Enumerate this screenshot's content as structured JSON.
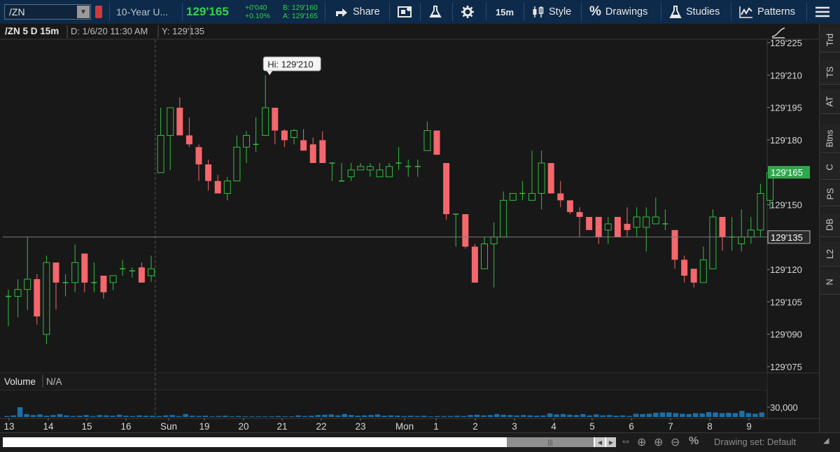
{
  "toolbar": {
    "symbol": "/ZN",
    "description": "10-Year U...",
    "last_price": "129'165",
    "net_change": "+0'040",
    "net_change_pct": "+0.10%",
    "bid": "B: 129'160",
    "ask": "A: 129'165",
    "share_label": "Share",
    "timeframe": "15m",
    "style_label": "Style",
    "drawings_label": "Drawings",
    "studies_label": "Studies",
    "patterns_label": "Patterns"
  },
  "chart_header": {
    "title": "/ZN 5 D 15m",
    "cursor_date": "D: 1/6/20 11:30 AM",
    "cursor_y": "Y: 129'135"
  },
  "volume_header": {
    "label": "Volume",
    "value": "N/A"
  },
  "sidebar": {
    "tabs": [
      "Trd",
      "TS",
      "AT",
      "Btns",
      "C",
      "PS",
      "DB",
      "L2",
      "N"
    ]
  },
  "bottom_bar": {
    "drawing_set": "Drawing set: Default"
  },
  "colors": {
    "up": "#2fbf3f",
    "down": "#f4676c",
    "price_label_bg": "#2ea84c",
    "toolbar_bg": "#0d2a4a"
  },
  "chart_data": {
    "type": "candlestick",
    "title": "/ZN 5 D 15m",
    "price_scale": "32nds",
    "y_ticks": [
      "129'225",
      "129'210",
      "129'195",
      "129'180",
      "129'150",
      "129'120",
      "129'105",
      "129'090",
      "129'075"
    ],
    "y_tick_values": [
      129.703125,
      129.65625,
      129.609375,
      129.5625,
      129.46875,
      129.375,
      129.328125,
      129.28125,
      129.234375
    ],
    "ylim": [
      129.234375,
      129.703125
    ],
    "x_labels": [
      "13",
      "14",
      "15",
      "16",
      "Sun",
      "19",
      "20",
      "21",
      "22",
      "23",
      "Mon",
      "1",
      "2",
      "3",
      "4",
      "5",
      "6",
      "7",
      "8",
      "9"
    ],
    "session_divider_after_label": "16",
    "annotation": {
      "text": "Hi: 129'210",
      "value": 129.65625,
      "bar_index": 27
    },
    "last_price": {
      "text": "129'165",
      "value": 129.515625
    },
    "cursor_price": {
      "text": "129'135",
      "value": 129.421875
    },
    "volume_tick": "30,000",
    "volume_tick_value": 30000,
    "candles": [
      {
        "o": 129.336,
        "h": 129.346,
        "l": 129.293,
        "c": 129.336
      },
      {
        "o": 129.336,
        "h": 129.361,
        "l": 129.306,
        "c": 129.346
      },
      {
        "o": 129.346,
        "h": 129.422,
        "l": 129.316,
        "c": 129.361
      },
      {
        "o": 129.361,
        "h": 129.368,
        "l": 129.295,
        "c": 129.307
      },
      {
        "o": 129.281,
        "h": 129.395,
        "l": 129.267,
        "c": 129.385
      },
      {
        "o": 129.385,
        "h": 129.385,
        "l": 129.317,
        "c": 129.356
      },
      {
        "o": 129.356,
        "h": 129.368,
        "l": 129.336,
        "c": 129.356
      },
      {
        "o": 129.356,
        "h": 129.411,
        "l": 129.342,
        "c": 129.385
      },
      {
        "o": 129.398,
        "h": 129.398,
        "l": 129.342,
        "c": 129.356
      },
      {
        "o": 129.356,
        "h": 129.385,
        "l": 129.342,
        "c": 129.356
      },
      {
        "o": 129.366,
        "h": 129.366,
        "l": 129.333,
        "c": 129.342
      },
      {
        "o": 129.356,
        "h": 129.366,
        "l": 129.345,
        "c": 129.366
      },
      {
        "o": 129.376,
        "h": 129.389,
        "l": 129.366,
        "c": 129.376
      },
      {
        "o": 129.373,
        "h": 129.378,
        "l": 129.363,
        "c": 129.373
      },
      {
        "o": 129.378,
        "h": 129.385,
        "l": 129.356,
        "c": 129.356
      },
      {
        "o": 129.366,
        "h": 129.395,
        "l": 129.357,
        "c": 129.376
      },
      {
        "o": 129.515,
        "h": 129.609,
        "l": 129.515,
        "c": 129.569
      },
      {
        "o": 129.569,
        "h": 129.609,
        "l": 129.519,
        "c": 129.609
      },
      {
        "o": 129.609,
        "h": 129.624,
        "l": 129.569,
        "c": 129.569
      },
      {
        "o": 129.569,
        "h": 129.595,
        "l": 129.552,
        "c": 129.556
      },
      {
        "o": 129.552,
        "h": 129.556,
        "l": 129.503,
        "c": 129.527
      },
      {
        "o": 129.527,
        "h": 129.534,
        "l": 129.489,
        "c": 129.503
      },
      {
        "o": 129.503,
        "h": 129.512,
        "l": 129.485,
        "c": 129.485
      },
      {
        "o": 129.485,
        "h": 129.509,
        "l": 129.475,
        "c": 129.503
      },
      {
        "o": 129.503,
        "h": 129.569,
        "l": 129.503,
        "c": 129.552
      },
      {
        "o": 129.552,
        "h": 129.575,
        "l": 129.529,
        "c": 129.569
      },
      {
        "o": 129.556,
        "h": 129.595,
        "l": 129.545,
        "c": 129.556
      },
      {
        "o": 129.569,
        "h": 129.656,
        "l": 129.569,
        "c": 129.609
      },
      {
        "o": 129.609,
        "h": 129.609,
        "l": 129.556,
        "c": 129.576
      },
      {
        "o": 129.576,
        "h": 129.578,
        "l": 129.552,
        "c": 129.562
      },
      {
        "o": 129.566,
        "h": 129.578,
        "l": 129.556,
        "c": 129.576
      },
      {
        "o": 129.562,
        "h": 129.578,
        "l": 129.547,
        "c": 129.547
      },
      {
        "o": 129.556,
        "h": 129.566,
        "l": 129.529,
        "c": 129.529
      },
      {
        "o": 129.562,
        "h": 129.575,
        "l": 129.529,
        "c": 129.529
      },
      {
        "o": 129.529,
        "h": 129.529,
        "l": 129.503,
        "c": 129.529
      },
      {
        "o": 129.503,
        "h": 129.529,
        "l": 129.503,
        "c": 129.503
      },
      {
        "o": 129.509,
        "h": 129.529,
        "l": 129.503,
        "c": 129.519
      },
      {
        "o": 129.519,
        "h": 129.529,
        "l": 129.519,
        "c": 129.524
      },
      {
        "o": 129.519,
        "h": 129.529,
        "l": 129.509,
        "c": 129.524
      },
      {
        "o": 129.509,
        "h": 129.529,
        "l": 129.509,
        "c": 129.519
      },
      {
        "o": 129.509,
        "h": 129.529,
        "l": 129.509,
        "c": 129.524
      },
      {
        "o": 129.529,
        "h": 129.552,
        "l": 129.519,
        "c": 129.529
      },
      {
        "o": 129.524,
        "h": 129.534,
        "l": 129.509,
        "c": 129.524
      },
      {
        "o": 129.524,
        "h": 129.534,
        "l": 129.509,
        "c": 129.524
      },
      {
        "o": 129.547,
        "h": 129.589,
        "l": 129.547,
        "c": 129.576
      },
      {
        "o": 129.576,
        "h": 129.576,
        "l": 129.541,
        "c": 129.541
      },
      {
        "o": 129.529,
        "h": 129.529,
        "l": 129.447,
        "c": 129.455
      },
      {
        "o": 129.455,
        "h": 129.455,
        "l": 129.408,
        "c": 129.455
      },
      {
        "o": 129.455,
        "h": 129.455,
        "l": 129.405,
        "c": 129.408
      },
      {
        "o": 129.408,
        "h": 129.412,
        "l": 129.356,
        "c": 129.356
      },
      {
        "o": 129.376,
        "h": 129.422,
        "l": 129.376,
        "c": 129.412
      },
      {
        "o": 129.412,
        "h": 129.443,
        "l": 129.349,
        "c": 129.422
      },
      {
        "o": 129.422,
        "h": 129.488,
        "l": 129.422,
        "c": 129.475
      },
      {
        "o": 129.475,
        "h": 129.485,
        "l": 129.475,
        "c": 129.485
      },
      {
        "o": 129.485,
        "h": 129.503,
        "l": 129.475,
        "c": 129.485
      },
      {
        "o": 129.475,
        "h": 129.547,
        "l": 129.475,
        "c": 129.485
      },
      {
        "o": 129.485,
        "h": 129.547,
        "l": 129.462,
        "c": 129.529
      },
      {
        "o": 129.529,
        "h": 129.529,
        "l": 129.485,
        "c": 129.485
      },
      {
        "o": 129.485,
        "h": 129.503,
        "l": 129.465,
        "c": 129.475
      },
      {
        "o": 129.475,
        "h": 129.475,
        "l": 129.455,
        "c": 129.458
      },
      {
        "o": 129.458,
        "h": 129.465,
        "l": 129.422,
        "c": 129.451
      },
      {
        "o": 129.451,
        "h": 129.451,
        "l": 129.441,
        "c": 129.432
      },
      {
        "o": 129.451,
        "h": 129.451,
        "l": 129.412,
        "c": 129.422
      },
      {
        "o": 129.432,
        "h": 129.451,
        "l": 129.412,
        "c": 129.441
      },
      {
        "o": 129.451,
        "h": 129.451,
        "l": 129.422,
        "c": 129.422
      },
      {
        "o": 129.441,
        "h": 129.465,
        "l": 129.422,
        "c": 129.432
      },
      {
        "o": 129.436,
        "h": 129.465,
        "l": 129.422,
        "c": 129.451
      },
      {
        "o": 129.436,
        "h": 129.465,
        "l": 129.401,
        "c": 129.451
      },
      {
        "o": 129.441,
        "h": 129.479,
        "l": 129.441,
        "c": 129.451
      },
      {
        "o": 129.441,
        "h": 129.462,
        "l": 129.432,
        "c": 129.441
      },
      {
        "o": 129.432,
        "h": 129.432,
        "l": 129.376,
        "c": 129.389
      },
      {
        "o": 129.389,
        "h": 129.395,
        "l": 129.356,
        "c": 129.366
      },
      {
        "o": 129.376,
        "h": 129.376,
        "l": 129.349,
        "c": 129.356
      },
      {
        "o": 129.356,
        "h": 129.408,
        "l": 129.356,
        "c": 129.389
      },
      {
        "o": 129.376,
        "h": 129.462,
        "l": 129.376,
        "c": 129.451
      },
      {
        "o": 129.451,
        "h": 129.451,
        "l": 129.402,
        "c": 129.422
      },
      {
        "o": 129.422,
        "h": 129.451,
        "l": 129.402,
        "c": 129.422
      },
      {
        "o": 129.412,
        "h": 129.462,
        "l": 129.401,
        "c": 129.422
      },
      {
        "o": 129.422,
        "h": 129.451,
        "l": 129.412,
        "c": 129.432
      },
      {
        "o": 129.432,
        "h": 129.499,
        "l": 129.422,
        "c": 129.485
      },
      {
        "o": 129.475,
        "h": 129.519,
        "l": 129.462,
        "c": 129.515
      }
    ],
    "volume": [
      3000,
      5000,
      30000,
      9000,
      6000,
      8000,
      4000,
      6000,
      9000,
      5000,
      3000,
      4000,
      6000,
      3000,
      6000,
      5000,
      4000,
      7000,
      4000,
      3000,
      5000,
      4000,
      4000,
      3000,
      5000,
      6000,
      3000,
      9000,
      4000,
      3000,
      4000,
      2000,
      3000,
      4000,
      2000,
      3000,
      2000,
      2000,
      2000,
      2000,
      2000,
      3000,
      2000,
      2000,
      5000,
      3000,
      4000,
      6000,
      7000,
      8000,
      5000,
      9000,
      6000,
      4000,
      5000,
      6000,
      8000,
      4000,
      5000,
      4000,
      3000,
      4000,
      3000,
      4000,
      2000,
      3000,
      3000,
      3000,
      4000,
      3000,
      6000,
      7000,
      5000,
      6000,
      9000,
      7000,
      6000,
      5000,
      6000,
      5000,
      4000,
      5000,
      11000,
      8000,
      9000,
      7000,
      6000,
      9000,
      5000,
      8000,
      5000,
      6000,
      4000,
      5000,
      3000,
      10000,
      9000,
      10000,
      13000,
      14000,
      14000,
      12000,
      10000,
      9000,
      12000,
      11000,
      15000,
      14000,
      12000,
      13000,
      12000,
      19000,
      12000,
      10000,
      14000
    ]
  }
}
